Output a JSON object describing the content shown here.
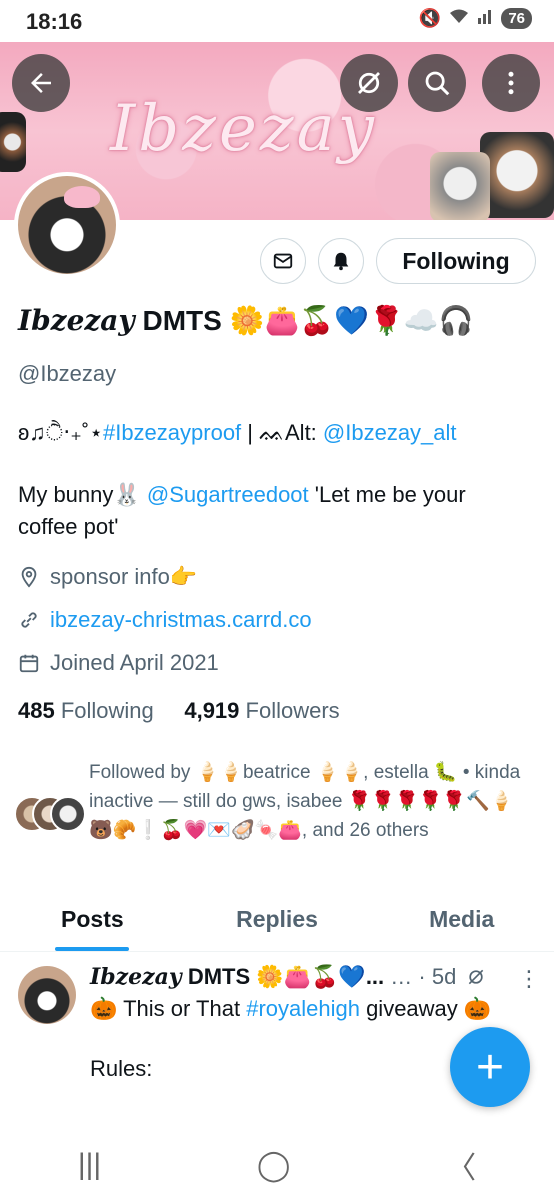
{
  "status_bar": {
    "time": "18:16",
    "battery": "76"
  },
  "banner": {
    "title": "Ibzezay"
  },
  "profile": {
    "display_name_fancy": "Ibzezay",
    "display_name_rest": " DMTS 🌼👛🍒💙🌹☁️🎧",
    "handle": "@Ibzezay",
    "bio_line1_prefix": "ʚ♫ੈ‧₊˚⋆",
    "bio_line1_hashtag": "#Ibzezayproof",
    "bio_line1_mid": " | ᨐAlt: ",
    "bio_line1_alt": "@Ibzezay_alt",
    "bio_line2_prefix": "My bunny🐰 ",
    "bio_line2_mention": "@Sugartreedoot",
    "bio_line2_suffix": " 'Let me be your",
    "bio_line3": "coffee pot'",
    "location": "sponsor info👉",
    "website": "ibzezay-christmas.carrd.co",
    "joined": "Joined April 2021",
    "following_count": "485",
    "following_label": "Following",
    "followers_count": "4,919",
    "followers_label": "Followers",
    "followed_by": "Followed by 🍦🍦beatrice 🍦🍦, estella 🐛 • kinda inactive — still do gws, isabee 🌹🌹🌹🌹🌹🔨🍦🐻🥐❕🍒💗💌🦪🍬👛, and 26 others"
  },
  "actions": {
    "following_label": "Following"
  },
  "tabs": [
    {
      "label": "Posts"
    },
    {
      "label": "Replies"
    },
    {
      "label": "Media"
    }
  ],
  "tweet": {
    "name_fancy": "Ibzezay",
    "name_rest": " DMTS 🌼👛🍒💙...",
    "meta": " … · 5d",
    "text_prefix": "🎃 This or That ",
    "text_hashtag": "#royalehigh",
    "text_suffix": " giveaway 🎃",
    "text_rules": "Rules:"
  },
  "fab": {
    "label": "+"
  },
  "nav": {
    "recents": "|||",
    "home": "◯",
    "back": "〈"
  },
  "colors": {
    "accent": "#1d9bf0",
    "text": "#0f1419",
    "secondary": "#536471"
  }
}
